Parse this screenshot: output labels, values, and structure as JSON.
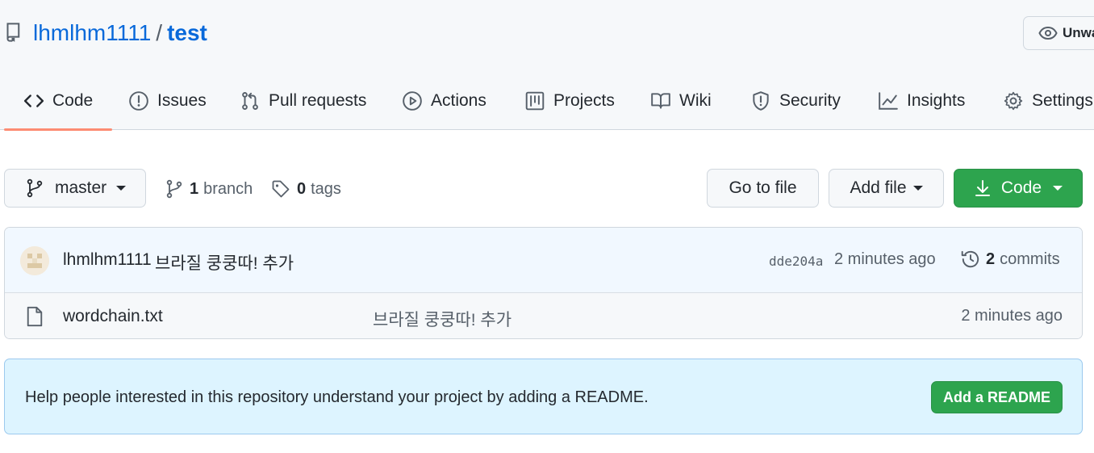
{
  "repo": {
    "owner": "lhmlhm1111",
    "separator": "/",
    "name": "test",
    "watch_label": "Unwatch"
  },
  "tabs": [
    {
      "label": "Code",
      "icon": "code-icon",
      "active": true
    },
    {
      "label": "Issues",
      "icon": "issue-opened-icon"
    },
    {
      "label": "Pull requests",
      "icon": "git-pull-request-icon"
    },
    {
      "label": "Actions",
      "icon": "play-icon"
    },
    {
      "label": "Projects",
      "icon": "project-icon"
    },
    {
      "label": "Wiki",
      "icon": "book-icon"
    },
    {
      "label": "Security",
      "icon": "shield-icon"
    },
    {
      "label": "Insights",
      "icon": "graph-icon"
    },
    {
      "label": "Settings",
      "icon": "gear-icon"
    }
  ],
  "toolbar": {
    "branch": "master",
    "branch_count": "1",
    "branch_label": "branch",
    "tag_count": "0",
    "tag_label": "tags",
    "go_to_file": "Go to file",
    "add_file": "Add file",
    "code": "Code"
  },
  "commit": {
    "author": "lhmlhm1111",
    "message": "브라질 쿵쿵따! 추가",
    "sha": "dde204a",
    "time": "2 minutes ago",
    "count": "2",
    "count_label": "commits"
  },
  "files": [
    {
      "name": "wordchain.txt",
      "message": "브라질 쿵쿵따! 추가",
      "time": "2 minutes ago"
    }
  ],
  "readme": {
    "text": "Help people interested in this repository understand your project by adding a README.",
    "button": "Add a README"
  },
  "colors": {
    "link": "#0969da",
    "primary_button": "#2da44e",
    "active_tab_underline": "#fd8c73",
    "readme_bg": "#ddf4ff"
  }
}
